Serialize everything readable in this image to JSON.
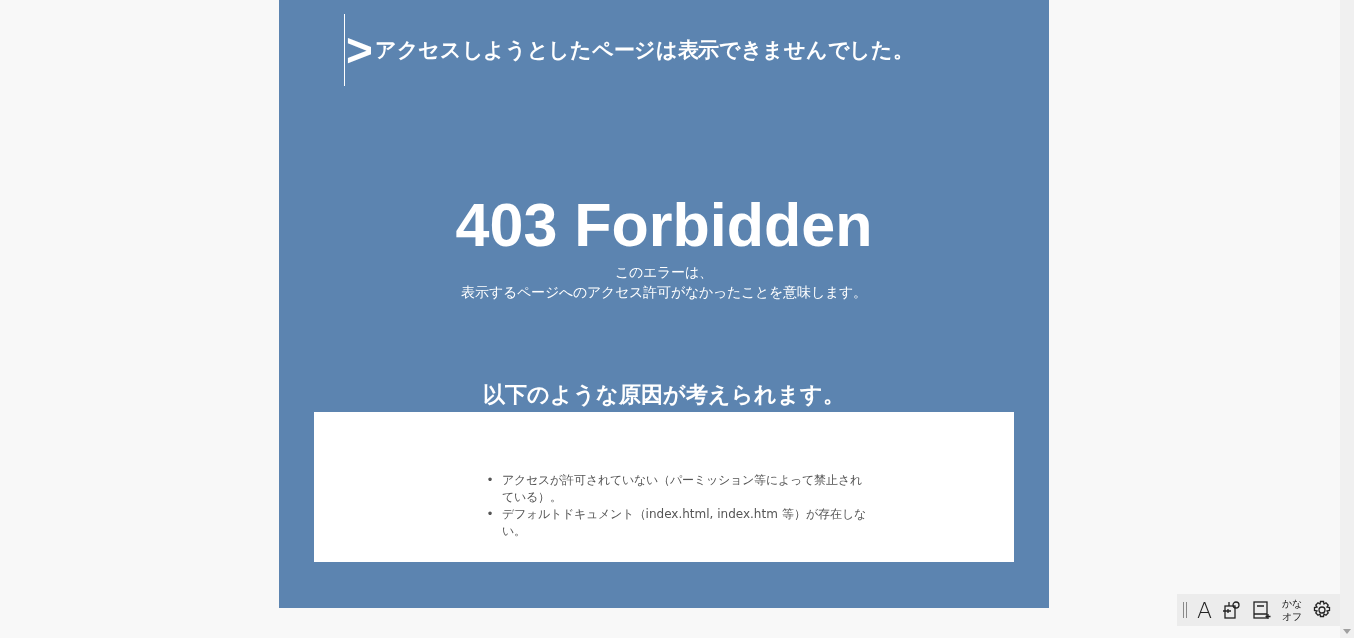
{
  "header": {
    "mark": ">",
    "title": "アクセスしようとしたページは表示できませんでした。"
  },
  "error": {
    "heading": "403 Forbidden",
    "description": [
      "このエラーは、",
      "表示するページへのアクセス許可がなかったことを意味します。"
    ]
  },
  "causes": {
    "heading": "以下のような原因が考えられます。",
    "items": [
      {
        "bullet": "•",
        "text": "アクセスが許可されていない（パーミッション等によって禁止されている）。"
      },
      {
        "bullet": "•",
        "text": "デフォルトドキュメント（index.html, index.htm 等）が存在しない。"
      }
    ]
  },
  "ime_toolbar": {
    "mode": "A",
    "kana": [
      "かな",
      "オフ"
    ]
  }
}
